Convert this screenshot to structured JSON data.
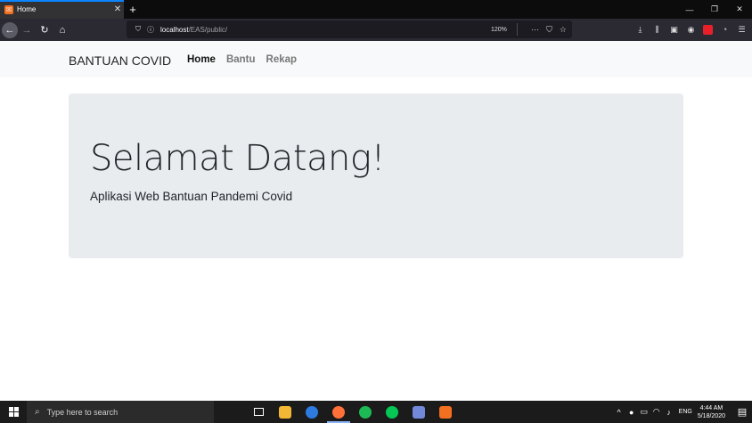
{
  "browser": {
    "tab": {
      "title": "Home",
      "favicon_letter": "☒"
    },
    "url": {
      "host": "localhost",
      "path": "/EAS/public/"
    },
    "zoom": "120%"
  },
  "page": {
    "brand": "BANTUAN COVID",
    "nav": [
      {
        "label": "Home",
        "active": true
      },
      {
        "label": "Bantu",
        "active": false
      },
      {
        "label": "Rekap",
        "active": false
      }
    ],
    "jumbotron": {
      "title": "Selamat Datang!",
      "lead": "Aplikasi Web Bantuan Pandemi Covid"
    }
  },
  "taskbar": {
    "search_placeholder": "Type here to search",
    "lang": "ENG",
    "time": "4:44 AM",
    "date": "5/18/2020",
    "apps": [
      "task-view",
      "file-explorer",
      "signal",
      "firefox",
      "spotify",
      "line",
      "discord",
      "xampp"
    ]
  },
  "colors": {
    "jumbotron_bg": "#e9ecef",
    "navbar_bg": "#f8f9fa",
    "accent": "#0a84ff"
  }
}
